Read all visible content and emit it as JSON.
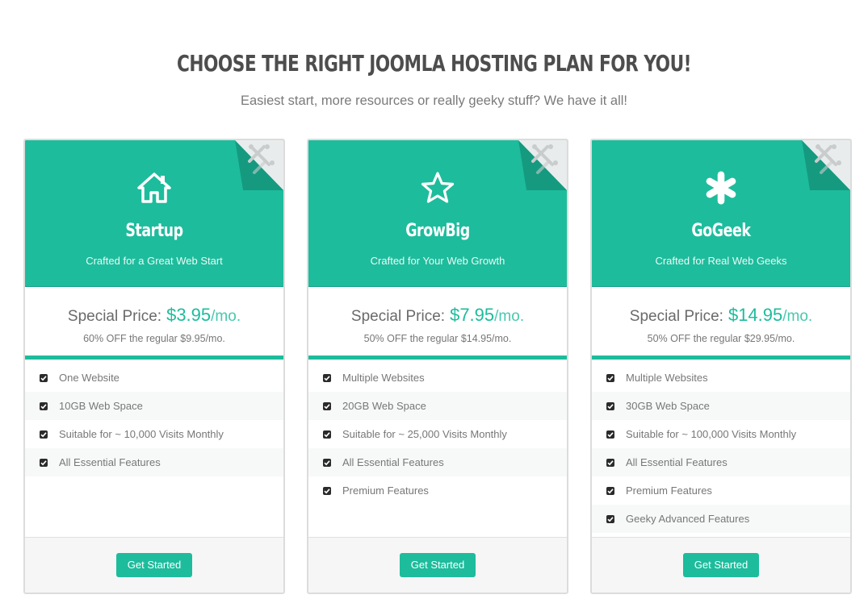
{
  "header": {
    "title": "CHOOSE THE RIGHT JOOMLA HOSTING PLAN FOR YOU!",
    "subtitle": "Easiest start, more resources or really geeky stuff? We have it all!"
  },
  "colors": {
    "accent": "#1dbc9c",
    "accent_dark": "#17a387"
  },
  "plans": [
    {
      "icon": "home-icon",
      "name": "Startup",
      "tagline": "Crafted for a Great Web Start",
      "price_label": "Special Price:",
      "price": "$3.95",
      "price_unit": "/mo.",
      "price_note": "60% OFF the regular $9.95/mo.",
      "features": [
        "One Website",
        "10GB Web Space",
        "Suitable for ~ 10,000 Visits Monthly",
        "All Essential Features"
      ],
      "cta": "Get Started"
    },
    {
      "icon": "star-icon",
      "name": "GrowBig",
      "tagline": "Crafted for Your Web Growth",
      "price_label": "Special Price:",
      "price": "$7.95",
      "price_unit": "/mo.",
      "price_note": "50% OFF the regular $14.95/mo.",
      "features": [
        "Multiple Websites",
        "20GB Web Space",
        "Suitable for ~ 25,000 Visits Monthly",
        "All Essential Features",
        "Premium Features"
      ],
      "cta": "Get Started"
    },
    {
      "icon": "asterisk-icon",
      "name": "GoGeek",
      "tagline": "Crafted for Real Web Geeks",
      "price_label": "Special Price:",
      "price": "$14.95",
      "price_unit": "/mo.",
      "price_note": "50% OFF the regular $29.95/mo.",
      "features": [
        "Multiple Websites",
        "30GB Web Space",
        "Suitable for ~ 100,000 Visits Monthly",
        "All Essential Features",
        "Premium Features",
        "Geeky Advanced Features"
      ],
      "cta": "Get Started"
    }
  ]
}
